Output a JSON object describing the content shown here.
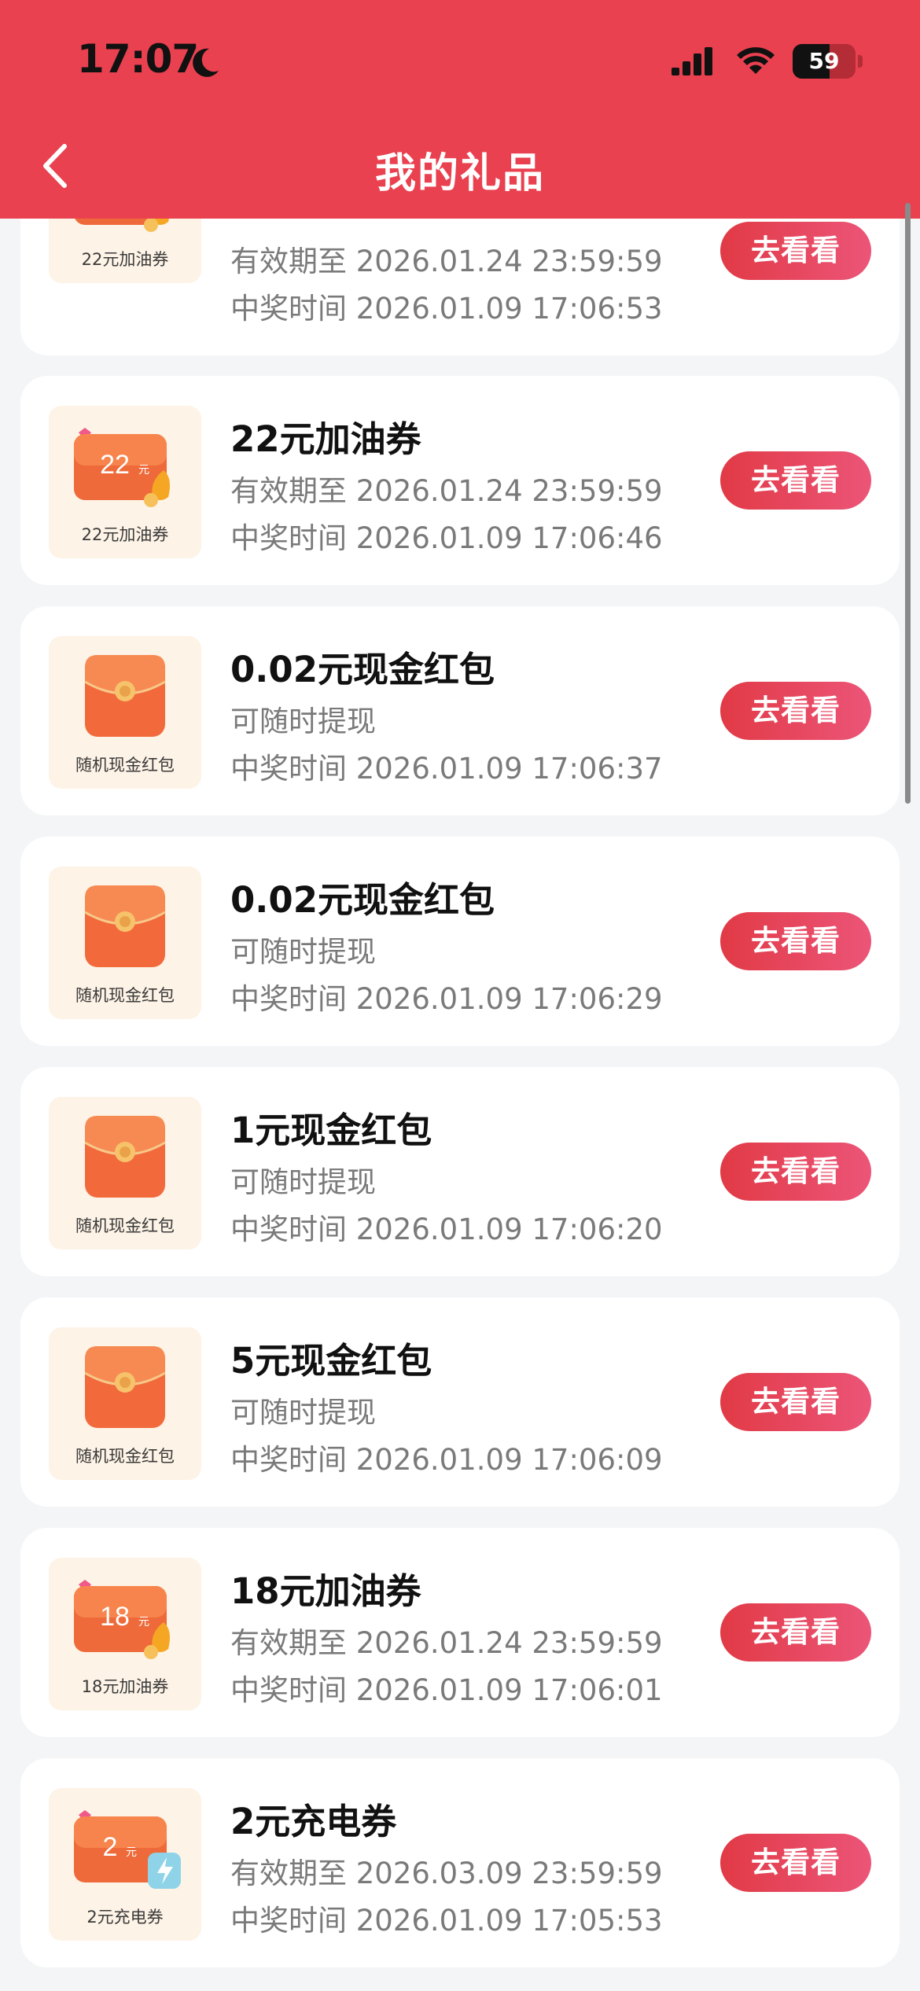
{
  "status_bar": {
    "time": "17:07",
    "battery": "59",
    "battery_level": 0.59
  },
  "nav": {
    "title": "我的礼品"
  },
  "button_label": "去看看",
  "items": [
    {
      "kind": "voucher",
      "title": "",
      "thumb_amount": "22",
      "thumb_unit": "元",
      "thumb_label": "22元加油券",
      "line1": "有效期至 2026.01.24 23:59:59",
      "line2": "中奖时间 2026.01.09 17:06:53"
    },
    {
      "kind": "voucher",
      "title": "22元加油券",
      "thumb_amount": "22",
      "thumb_unit": "元",
      "thumb_label": "22元加油券",
      "line1": "有效期至 2026.01.24 23:59:59",
      "line2": "中奖时间 2026.01.09 17:06:46"
    },
    {
      "kind": "envelope",
      "title": "0.02元现金红包",
      "thumb_label": "随机现金红包",
      "line1": "可随时提现",
      "line2": "中奖时间 2026.01.09 17:06:37"
    },
    {
      "kind": "envelope",
      "title": "0.02元现金红包",
      "thumb_label": "随机现金红包",
      "line1": "可随时提现",
      "line2": "中奖时间 2026.01.09 17:06:29"
    },
    {
      "kind": "envelope",
      "title": "1元现金红包",
      "thumb_label": "随机现金红包",
      "line1": "可随时提现",
      "line2": "中奖时间 2026.01.09 17:06:20"
    },
    {
      "kind": "envelope",
      "title": "5元现金红包",
      "thumb_label": "随机现金红包",
      "line1": "可随时提现",
      "line2": "中奖时间 2026.01.09 17:06:09"
    },
    {
      "kind": "voucher",
      "title": "18元加油券",
      "thumb_amount": "18",
      "thumb_unit": "元",
      "thumb_label": "18元加油券",
      "line1": "有效期至 2026.01.24 23:59:59",
      "line2": "中奖时间 2026.01.09 17:06:01"
    },
    {
      "kind": "charge",
      "title": "2元充电券",
      "thumb_amount": "2",
      "thumb_unit": "元",
      "thumb_label": "2元充电券",
      "line1": "有效期至 2026.03.09 23:59:59",
      "line2": "中奖时间 2026.01.09 17:05:53"
    }
  ]
}
